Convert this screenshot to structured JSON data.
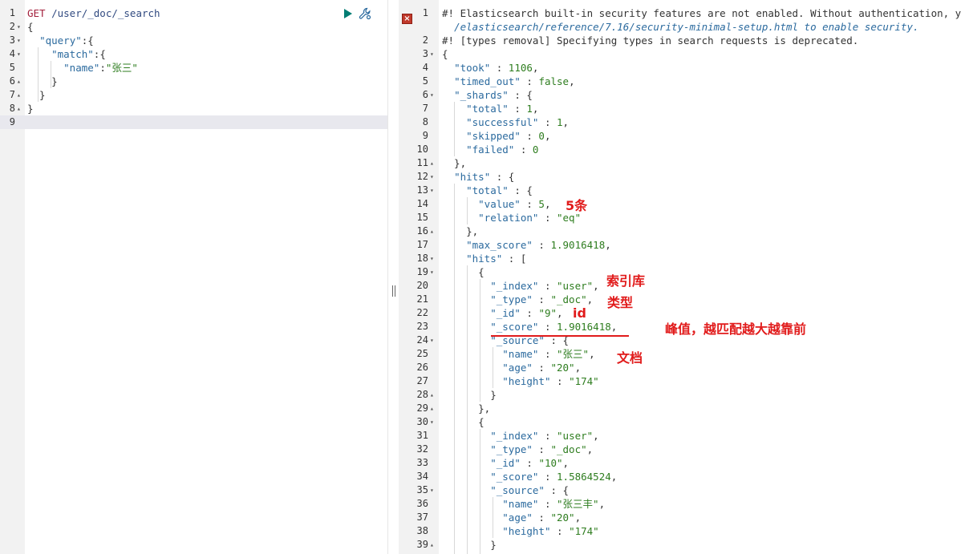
{
  "request_editor": {
    "lines": [
      {
        "num": "1",
        "fold": "",
        "tokens": [
          {
            "t": "GET",
            "c": "t-method"
          },
          {
            "t": " /user/_doc/_search",
            "c": "t-url"
          }
        ]
      },
      {
        "num": "2",
        "fold": "▾",
        "tokens": [
          {
            "t": "{",
            "c": "t-punc"
          }
        ]
      },
      {
        "num": "3",
        "fold": "▾",
        "tokens": [
          {
            "t": "  ",
            "c": "t-punc"
          },
          {
            "t": "\"query\"",
            "c": "t-key"
          },
          {
            "t": ":{",
            "c": "t-punc"
          }
        ]
      },
      {
        "num": "4",
        "fold": "▾",
        "tokens": [
          {
            "t": "    ",
            "c": "t-punc"
          },
          {
            "t": "\"match\"",
            "c": "t-key"
          },
          {
            "t": ":{",
            "c": "t-punc"
          }
        ]
      },
      {
        "num": "5",
        "fold": "",
        "tokens": [
          {
            "t": "      ",
            "c": "t-punc"
          },
          {
            "t": "\"name\"",
            "c": "t-key"
          },
          {
            "t": ":",
            "c": "t-punc"
          },
          {
            "t": "\"张三\"",
            "c": "t-str"
          }
        ]
      },
      {
        "num": "6",
        "fold": "▴",
        "tokens": [
          {
            "t": "    }",
            "c": "t-punc"
          }
        ]
      },
      {
        "num": "7",
        "fold": "▴",
        "tokens": [
          {
            "t": "  }",
            "c": "t-punc"
          }
        ]
      },
      {
        "num": "8",
        "fold": "▴",
        "tokens": [
          {
            "t": "}",
            "c": "t-punc"
          }
        ]
      },
      {
        "num": "9",
        "fold": "",
        "tokens": [],
        "active": true
      }
    ]
  },
  "response_viewer": {
    "lines": [
      {
        "num": "1",
        "fold": "",
        "tokens": [
          {
            "t": "#! Elasticsearch built-in security features are not enabled. Without authentication, y",
            "c": "t-comment"
          }
        ]
      },
      {
        "num": "",
        "fold": "",
        "tokens": [
          {
            "t": "  ",
            "c": "t-punc"
          },
          {
            "t": "/elasticsearch/reference/7.16/security-minimal-setup.html to enable security.",
            "c": "t-link"
          }
        ]
      },
      {
        "num": "2",
        "fold": "",
        "tokens": [
          {
            "t": "#! [types removal] Specifying types in search requests is deprecated.",
            "c": "t-comment"
          }
        ]
      },
      {
        "num": "3",
        "fold": "▾",
        "tokens": [
          {
            "t": "{",
            "c": "t-punc"
          }
        ]
      },
      {
        "num": "4",
        "fold": "",
        "tokens": [
          {
            "t": "  ",
            "c": "t-punc"
          },
          {
            "t": "\"took\"",
            "c": "t-key"
          },
          {
            "t": " : ",
            "c": "t-punc"
          },
          {
            "t": "1106",
            "c": "t-num"
          },
          {
            "t": ",",
            "c": "t-punc"
          }
        ]
      },
      {
        "num": "5",
        "fold": "",
        "tokens": [
          {
            "t": "  ",
            "c": "t-punc"
          },
          {
            "t": "\"timed_out\"",
            "c": "t-key"
          },
          {
            "t": " : ",
            "c": "t-punc"
          },
          {
            "t": "false",
            "c": "t-kw"
          },
          {
            "t": ",",
            "c": "t-punc"
          }
        ]
      },
      {
        "num": "6",
        "fold": "▾",
        "tokens": [
          {
            "t": "  ",
            "c": "t-punc"
          },
          {
            "t": "\"_shards\"",
            "c": "t-key"
          },
          {
            "t": " : {",
            "c": "t-punc"
          }
        ]
      },
      {
        "num": "7",
        "fold": "",
        "tokens": [
          {
            "t": "    ",
            "c": "t-punc"
          },
          {
            "t": "\"total\"",
            "c": "t-key"
          },
          {
            "t": " : ",
            "c": "t-punc"
          },
          {
            "t": "1",
            "c": "t-num"
          },
          {
            "t": ",",
            "c": "t-punc"
          }
        ]
      },
      {
        "num": "8",
        "fold": "",
        "tokens": [
          {
            "t": "    ",
            "c": "t-punc"
          },
          {
            "t": "\"successful\"",
            "c": "t-key"
          },
          {
            "t": " : ",
            "c": "t-punc"
          },
          {
            "t": "1",
            "c": "t-num"
          },
          {
            "t": ",",
            "c": "t-punc"
          }
        ]
      },
      {
        "num": "9",
        "fold": "",
        "tokens": [
          {
            "t": "    ",
            "c": "t-punc"
          },
          {
            "t": "\"skipped\"",
            "c": "t-key"
          },
          {
            "t": " : ",
            "c": "t-punc"
          },
          {
            "t": "0",
            "c": "t-num"
          },
          {
            "t": ",",
            "c": "t-punc"
          }
        ]
      },
      {
        "num": "10",
        "fold": "",
        "tokens": [
          {
            "t": "    ",
            "c": "t-punc"
          },
          {
            "t": "\"failed\"",
            "c": "t-key"
          },
          {
            "t": " : ",
            "c": "t-punc"
          },
          {
            "t": "0",
            "c": "t-num"
          }
        ]
      },
      {
        "num": "11",
        "fold": "▴",
        "tokens": [
          {
            "t": "  },",
            "c": "t-punc"
          }
        ]
      },
      {
        "num": "12",
        "fold": "▾",
        "tokens": [
          {
            "t": "  ",
            "c": "t-punc"
          },
          {
            "t": "\"hits\"",
            "c": "t-key"
          },
          {
            "t": " : {",
            "c": "t-punc"
          }
        ]
      },
      {
        "num": "13",
        "fold": "▾",
        "tokens": [
          {
            "t": "    ",
            "c": "t-punc"
          },
          {
            "t": "\"total\"",
            "c": "t-key"
          },
          {
            "t": " : {",
            "c": "t-punc"
          }
        ]
      },
      {
        "num": "14",
        "fold": "",
        "tokens": [
          {
            "t": "      ",
            "c": "t-punc"
          },
          {
            "t": "\"value\"",
            "c": "t-key"
          },
          {
            "t": " : ",
            "c": "t-punc"
          },
          {
            "t": "5",
            "c": "t-num"
          },
          {
            "t": ",",
            "c": "t-punc"
          }
        ]
      },
      {
        "num": "15",
        "fold": "",
        "tokens": [
          {
            "t": "      ",
            "c": "t-punc"
          },
          {
            "t": "\"relation\"",
            "c": "t-key"
          },
          {
            "t": " : ",
            "c": "t-punc"
          },
          {
            "t": "\"eq\"",
            "c": "t-str"
          }
        ]
      },
      {
        "num": "16",
        "fold": "▴",
        "tokens": [
          {
            "t": "    },",
            "c": "t-punc"
          }
        ]
      },
      {
        "num": "17",
        "fold": "",
        "tokens": [
          {
            "t": "    ",
            "c": "t-punc"
          },
          {
            "t": "\"max_score\"",
            "c": "t-key"
          },
          {
            "t": " : ",
            "c": "t-punc"
          },
          {
            "t": "1.9016418",
            "c": "t-num"
          },
          {
            "t": ",",
            "c": "t-punc"
          }
        ]
      },
      {
        "num": "18",
        "fold": "▾",
        "tokens": [
          {
            "t": "    ",
            "c": "t-punc"
          },
          {
            "t": "\"hits\"",
            "c": "t-key"
          },
          {
            "t": " : [",
            "c": "t-punc"
          }
        ]
      },
      {
        "num": "19",
        "fold": "▾",
        "tokens": [
          {
            "t": "      {",
            "c": "t-punc"
          }
        ]
      },
      {
        "num": "20",
        "fold": "",
        "tokens": [
          {
            "t": "        ",
            "c": "t-punc"
          },
          {
            "t": "\"_index\"",
            "c": "t-key"
          },
          {
            "t": " : ",
            "c": "t-punc"
          },
          {
            "t": "\"user\"",
            "c": "t-str"
          },
          {
            "t": ",",
            "c": "t-punc"
          }
        ]
      },
      {
        "num": "21",
        "fold": "",
        "tokens": [
          {
            "t": "        ",
            "c": "t-punc"
          },
          {
            "t": "\"_type\"",
            "c": "t-key"
          },
          {
            "t": " : ",
            "c": "t-punc"
          },
          {
            "t": "\"_doc\"",
            "c": "t-str"
          },
          {
            "t": ",",
            "c": "t-punc"
          }
        ]
      },
      {
        "num": "22",
        "fold": "",
        "tokens": [
          {
            "t": "        ",
            "c": "t-punc"
          },
          {
            "t": "\"_id\"",
            "c": "t-key"
          },
          {
            "t": " : ",
            "c": "t-punc"
          },
          {
            "t": "\"9\"",
            "c": "t-str"
          },
          {
            "t": ",",
            "c": "t-punc"
          }
        ]
      },
      {
        "num": "23",
        "fold": "",
        "tokens": [
          {
            "t": "        ",
            "c": "t-punc"
          },
          {
            "t": "\"_score\"",
            "c": "t-key"
          },
          {
            "t": " : ",
            "c": "t-punc"
          },
          {
            "t": "1.9016418",
            "c": "t-num"
          },
          {
            "t": ",",
            "c": "t-punc"
          }
        ]
      },
      {
        "num": "24",
        "fold": "▾",
        "tokens": [
          {
            "t": "        ",
            "c": "t-punc"
          },
          {
            "t": "\"_source\"",
            "c": "t-key"
          },
          {
            "t": " : {",
            "c": "t-punc"
          }
        ]
      },
      {
        "num": "25",
        "fold": "",
        "tokens": [
          {
            "t": "          ",
            "c": "t-punc"
          },
          {
            "t": "\"name\"",
            "c": "t-key"
          },
          {
            "t": " : ",
            "c": "t-punc"
          },
          {
            "t": "\"张三\"",
            "c": "t-str"
          },
          {
            "t": ",",
            "c": "t-punc"
          }
        ]
      },
      {
        "num": "26",
        "fold": "",
        "tokens": [
          {
            "t": "          ",
            "c": "t-punc"
          },
          {
            "t": "\"age\"",
            "c": "t-key"
          },
          {
            "t": " : ",
            "c": "t-punc"
          },
          {
            "t": "\"20\"",
            "c": "t-str"
          },
          {
            "t": ",",
            "c": "t-punc"
          }
        ]
      },
      {
        "num": "27",
        "fold": "",
        "tokens": [
          {
            "t": "          ",
            "c": "t-punc"
          },
          {
            "t": "\"height\"",
            "c": "t-key"
          },
          {
            "t": " : ",
            "c": "t-punc"
          },
          {
            "t": "\"174\"",
            "c": "t-str"
          }
        ]
      },
      {
        "num": "28",
        "fold": "▴",
        "tokens": [
          {
            "t": "        }",
            "c": "t-punc"
          }
        ]
      },
      {
        "num": "29",
        "fold": "▴",
        "tokens": [
          {
            "t": "      },",
            "c": "t-punc"
          }
        ]
      },
      {
        "num": "30",
        "fold": "▾",
        "tokens": [
          {
            "t": "      {",
            "c": "t-punc"
          }
        ]
      },
      {
        "num": "31",
        "fold": "",
        "tokens": [
          {
            "t": "        ",
            "c": "t-punc"
          },
          {
            "t": "\"_index\"",
            "c": "t-key"
          },
          {
            "t": " : ",
            "c": "t-punc"
          },
          {
            "t": "\"user\"",
            "c": "t-str"
          },
          {
            "t": ",",
            "c": "t-punc"
          }
        ]
      },
      {
        "num": "32",
        "fold": "",
        "tokens": [
          {
            "t": "        ",
            "c": "t-punc"
          },
          {
            "t": "\"_type\"",
            "c": "t-key"
          },
          {
            "t": " : ",
            "c": "t-punc"
          },
          {
            "t": "\"_doc\"",
            "c": "t-str"
          },
          {
            "t": ",",
            "c": "t-punc"
          }
        ]
      },
      {
        "num": "33",
        "fold": "",
        "tokens": [
          {
            "t": "        ",
            "c": "t-punc"
          },
          {
            "t": "\"_id\"",
            "c": "t-key"
          },
          {
            "t": " : ",
            "c": "t-punc"
          },
          {
            "t": "\"10\"",
            "c": "t-str"
          },
          {
            "t": ",",
            "c": "t-punc"
          }
        ]
      },
      {
        "num": "34",
        "fold": "",
        "tokens": [
          {
            "t": "        ",
            "c": "t-punc"
          },
          {
            "t": "\"_score\"",
            "c": "t-key"
          },
          {
            "t": " : ",
            "c": "t-punc"
          },
          {
            "t": "1.5864524",
            "c": "t-num"
          },
          {
            "t": ",",
            "c": "t-punc"
          }
        ]
      },
      {
        "num": "35",
        "fold": "▾",
        "tokens": [
          {
            "t": "        ",
            "c": "t-punc"
          },
          {
            "t": "\"_source\"",
            "c": "t-key"
          },
          {
            "t": " : {",
            "c": "t-punc"
          }
        ]
      },
      {
        "num": "36",
        "fold": "",
        "tokens": [
          {
            "t": "          ",
            "c": "t-punc"
          },
          {
            "t": "\"name\"",
            "c": "t-key"
          },
          {
            "t": " : ",
            "c": "t-punc"
          },
          {
            "t": "\"张三丰\"",
            "c": "t-str"
          },
          {
            "t": ",",
            "c": "t-punc"
          }
        ]
      },
      {
        "num": "37",
        "fold": "",
        "tokens": [
          {
            "t": "          ",
            "c": "t-punc"
          },
          {
            "t": "\"age\"",
            "c": "t-key"
          },
          {
            "t": " : ",
            "c": "t-punc"
          },
          {
            "t": "\"20\"",
            "c": "t-str"
          },
          {
            "t": ",",
            "c": "t-punc"
          }
        ]
      },
      {
        "num": "38",
        "fold": "",
        "tokens": [
          {
            "t": "          ",
            "c": "t-punc"
          },
          {
            "t": "\"height\"",
            "c": "t-key"
          },
          {
            "t": " : ",
            "c": "t-punc"
          },
          {
            "t": "\"174\"",
            "c": "t-str"
          }
        ]
      },
      {
        "num": "39",
        "fold": "▴",
        "tokens": [
          {
            "t": "        }",
            "c": "t-punc"
          }
        ]
      }
    ]
  },
  "annotations": {
    "total_note": "5条",
    "index_note": "索引库",
    "type_note": "类型",
    "id_note": "id",
    "score_note": "峰值，越匹配越大越靠前",
    "source_note": "文档"
  },
  "icons": {
    "run": "play-icon",
    "settings": "wrench-icon",
    "warning": "error-icon",
    "resize": "split-handle-icon"
  },
  "colors": {
    "annotation": "#e11b1b",
    "run_button": "#017d73",
    "key": "#2b6a9e",
    "string": "#2e7d1f",
    "method": "#a3203c"
  }
}
